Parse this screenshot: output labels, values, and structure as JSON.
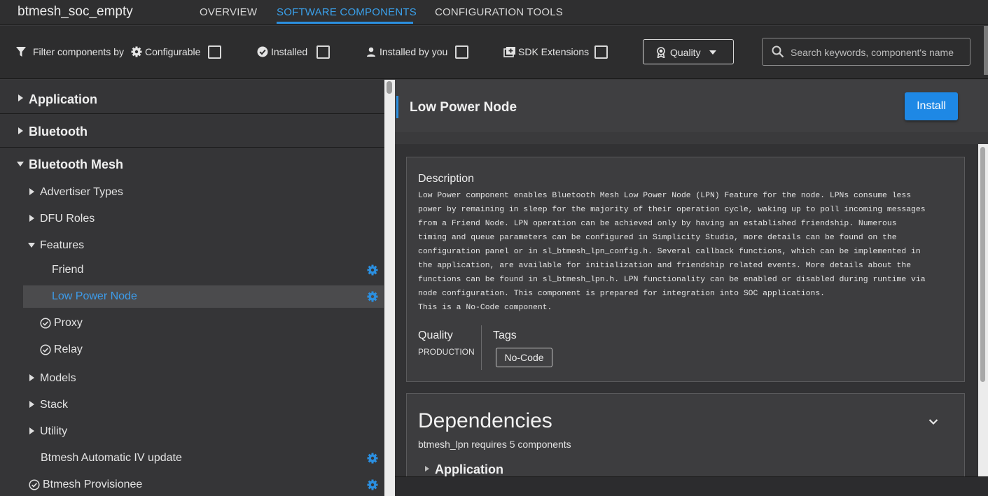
{
  "app": {
    "title": "btmesh_soc_empty"
  },
  "tabs": [
    {
      "label": "OVERVIEW",
      "active": false
    },
    {
      "label": "SOFTWARE COMPONENTS",
      "active": true
    },
    {
      "label": "CONFIGURATION TOOLS",
      "active": false
    }
  ],
  "filter": {
    "label": "Filter components by",
    "configurable": "Configurable",
    "installed": "Installed",
    "installed_by_you": "Installed by you",
    "sdk_extensions": "SDK Extensions",
    "quality": "Quality",
    "search_placeholder": "Search keywords, component's name"
  },
  "tree": {
    "categories": [
      "Application",
      "Bluetooth",
      "Bluetooth Mesh"
    ],
    "mesh_children": {
      "advertiser_types": "Advertiser Types",
      "dfu_roles": "DFU Roles",
      "features": "Features",
      "friend": "Friend",
      "low_power_node": "Low Power Node",
      "proxy": "Proxy",
      "relay": "Relay",
      "models": "Models",
      "stack": "Stack",
      "utility": "Utility",
      "auto_iv_update": "Btmesh Automatic IV update",
      "provisionee": "Btmesh Provisionee"
    }
  },
  "component": {
    "title": "Low Power Node",
    "install_label": "Install",
    "description_heading": "Description",
    "description": "Low Power component enables Bluetooth Mesh Low Power Node (LPN) Feature for the node. LPNs consume less\npower by remaining in sleep for the majority of their operation cycle, waking up to poll incoming messages\nfrom a Friend Node. LPN operation can be achieved only by having an established friendship. Numerous\ntiming and queue parameters can be configured in Simplicity Studio, more details can be found on the\nconfiguration panel or in sl_btmesh_lpn_config.h. Several callback functions, which can be implemented in\nthe application, are available for initialization and friendship related events. More details about the\nfunctions can be found in sl_btmesh_lpn.h. LPN functionality can be enabled or disabled during runtime via\nnode configuration. This component is prepared for integration into SOC applications.\nThis is a No-Code component.",
    "quality_label": "Quality",
    "quality_value": "PRODUCTION",
    "tags_label": "Tags",
    "tag": "No-Code",
    "dependencies_title": "Dependencies",
    "dependencies_sub": "btmesh_lpn requires 5 components",
    "dependency_first": "Application"
  },
  "colors": {
    "accent": "#2b8fe0",
    "install_button": "#1e88e5",
    "selected_text": "#3d9be9"
  }
}
